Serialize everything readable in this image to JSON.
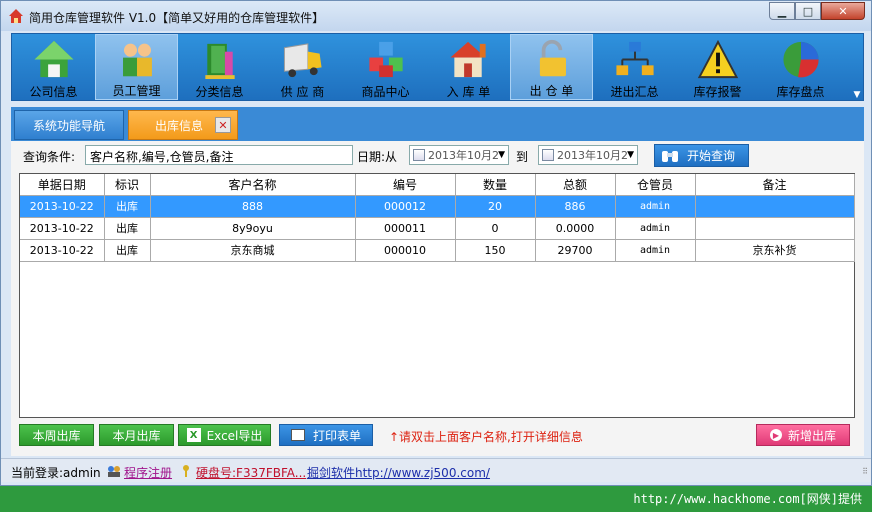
{
  "window": {
    "title": "简用仓库管理软件 V1.0【简单又好用的仓库管理软件】",
    "min_glyph": "▁",
    "max_glyph": "□",
    "close_glyph": "✕"
  },
  "toolbar": {
    "items": [
      {
        "label": "公司信息",
        "icon": "house-icon",
        "active": false
      },
      {
        "label": "员工管理",
        "icon": "staff-icon",
        "active": true
      },
      {
        "label": "分类信息",
        "icon": "books-icon",
        "active": false
      },
      {
        "label": "供 应 商",
        "icon": "truck-icon",
        "active": false
      },
      {
        "label": "商品中心",
        "icon": "cubes-icon",
        "active": false
      },
      {
        "label": "入 库 单",
        "icon": "warehouse-icon",
        "active": false
      },
      {
        "label": "出 仓 单",
        "icon": "padlock-icon",
        "active": true
      },
      {
        "label": "进出汇总",
        "icon": "org-chart-icon",
        "active": false
      },
      {
        "label": "库存报警",
        "icon": "warning-icon",
        "active": false
      },
      {
        "label": "库存盘点",
        "icon": "pie-chart-icon",
        "active": false
      }
    ],
    "scroll_glyph": "▼"
  },
  "tabs": {
    "nav": "系统功能导航",
    "current": "出库信息",
    "close_glyph": "✕"
  },
  "query": {
    "label": "查询条件:",
    "value": "客户名称,编号,仓管员,备注",
    "date_label": "日期:从",
    "date_from": "2013年10月2",
    "to_label": "到",
    "date_to": "2013年10月2",
    "dropdown_glyph": "▼",
    "search_label": "开始查询"
  },
  "table": {
    "columns": [
      "单据日期",
      "标识",
      "客户名称",
      "编号",
      "数量",
      "总额",
      "仓管员",
      "备注"
    ],
    "rows": [
      [
        "2013-10-22",
        "出库",
        "888",
        "000012",
        "20",
        "886",
        "admin",
        ""
      ],
      [
        "2013-10-22",
        "出库",
        "8y9oyu",
        "000011",
        "0",
        "0.0000",
        "admin",
        ""
      ],
      [
        "2013-10-22",
        "出库",
        "京东商城",
        "000010",
        "150",
        "29700",
        "admin",
        "京东补货"
      ]
    ],
    "selected_row": 0
  },
  "buttons": {
    "week": "本周出库",
    "month": "本月出库",
    "excel": "Excel导出",
    "print": "打印表单",
    "hint": "↑请双击上面客户名称,打开详细信息",
    "add": "新增出库"
  },
  "status": {
    "user": "当前登录:admin",
    "register": "程序注册",
    "disk": "硬盘号:F337FBFA...",
    "site": "掘剑软件http://www.zj500.com/",
    "grip": "⠿"
  },
  "watermark": "http://www.hackhome.com[网侠]提供",
  "colors": {
    "toolbar_bg": "#2f92dd",
    "tab_active": "#f39a1a",
    "selected_row": "#3399ff",
    "green_button": "#2c9a2c",
    "hint_red": "#d21111"
  }
}
